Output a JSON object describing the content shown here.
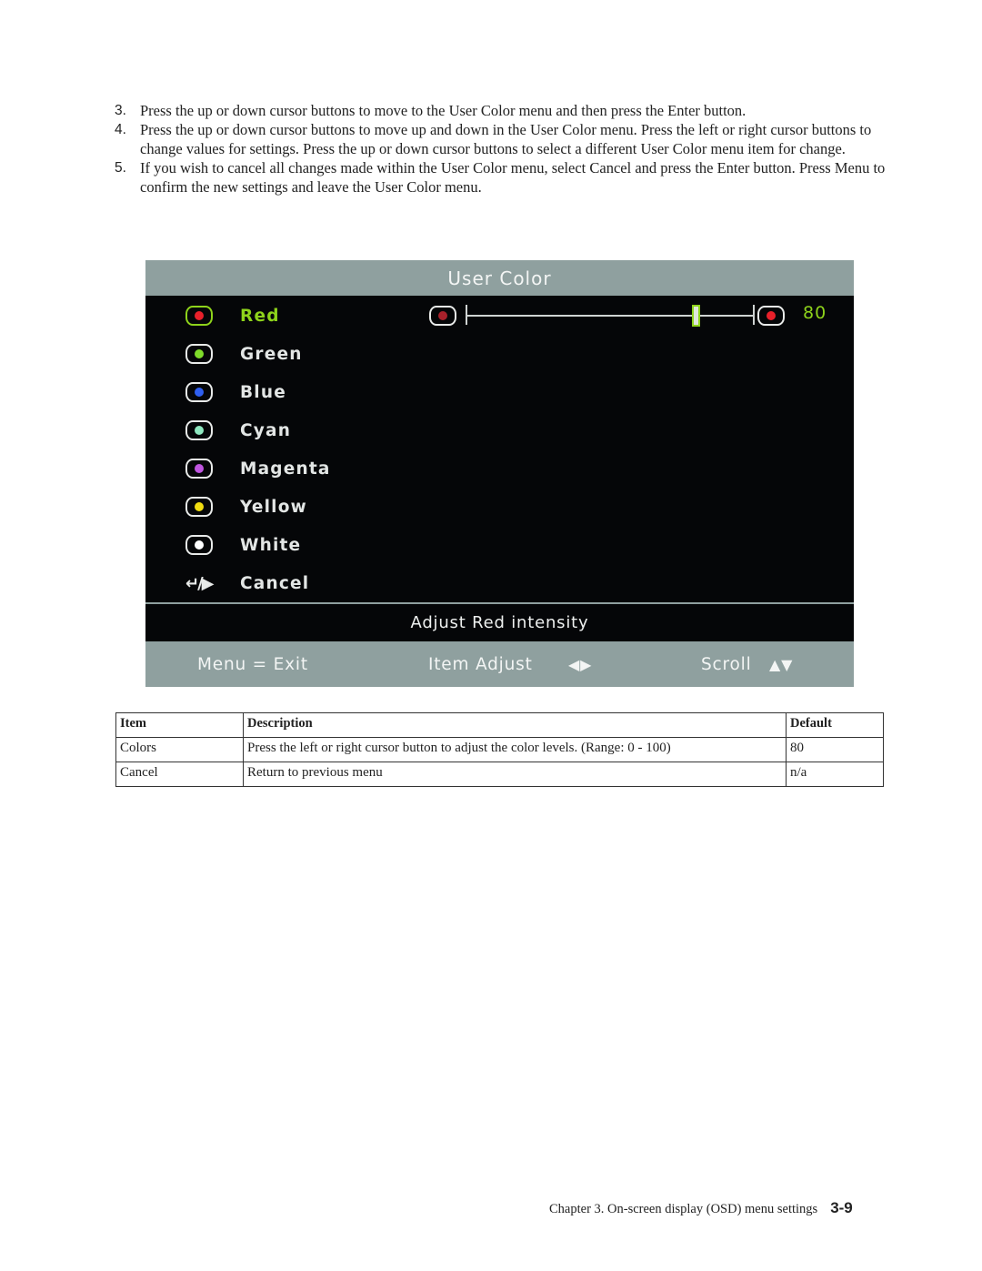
{
  "steps": [
    {
      "num": "3.",
      "text": "Press the up or down cursor buttons to move to the User Color menu and then press the Enter button."
    },
    {
      "num": "4.",
      "text": "Press the up or down cursor buttons to move up and down in the User Color menu. Press the left or right cursor buttons to change values for settings. Press the up or down cursor buttons to select a different User Color menu item for change."
    },
    {
      "num": "5.",
      "text": "If you wish to cancel all changes made within the User Color menu, select Cancel and press the Enter button. Press Menu to confirm the new settings and leave the User Color menu."
    }
  ],
  "osd": {
    "title": "User Color",
    "items": [
      {
        "label": "Red",
        "icon": "red-eye-icon",
        "dot_color": "#e8202a",
        "selected": true
      },
      {
        "label": "Green",
        "icon": "green-eye-icon",
        "dot_color": "#7fdc2a",
        "selected": false
      },
      {
        "label": "Blue",
        "icon": "blue-eye-icon",
        "dot_color": "#2f5ff0",
        "selected": false
      },
      {
        "label": "Cyan",
        "icon": "cyan-eye-icon",
        "dot_color": "#8fe8c0",
        "selected": false
      },
      {
        "label": "Magenta",
        "icon": "magenta-eye-icon",
        "dot_color": "#c056e0",
        "selected": false
      },
      {
        "label": "Yellow",
        "icon": "yellow-eye-icon",
        "dot_color": "#f0dc10",
        "selected": false
      },
      {
        "label": "White",
        "icon": "white-eye-icon",
        "dot_color": "#ffffff",
        "selected": false
      }
    ],
    "cancel": {
      "label": "Cancel",
      "icon": "enter-right-icon",
      "glyph": "↵/▶"
    },
    "slider": {
      "value": "80",
      "value_fraction": 0.8,
      "range": [
        0,
        100
      ],
      "min_dot_color": "#a8212b",
      "max_dot_color": "#e8202a"
    },
    "help_text": "Adjust Red intensity",
    "footer": {
      "exit": "Menu = Exit",
      "adjust": "Item Adjust",
      "adjust_glyph": "◀▶",
      "scroll": "Scroll",
      "scroll_glyph": "▲▼"
    },
    "colors": {
      "accent": "#8ed31b",
      "bar": "#8fa09f",
      "background": "#050608"
    }
  },
  "table": {
    "headers": [
      "Item",
      "Description",
      "Default"
    ],
    "rows": [
      [
        "Colors",
        "Press the left or right cursor button to adjust the color levels. (Range: 0 - 100)",
        "80"
      ],
      [
        "Cancel",
        "Return to previous menu",
        "n/a"
      ]
    ]
  },
  "footer": {
    "chapter": "Chapter 3. On-screen display (OSD) menu settings",
    "page": "3-9"
  }
}
